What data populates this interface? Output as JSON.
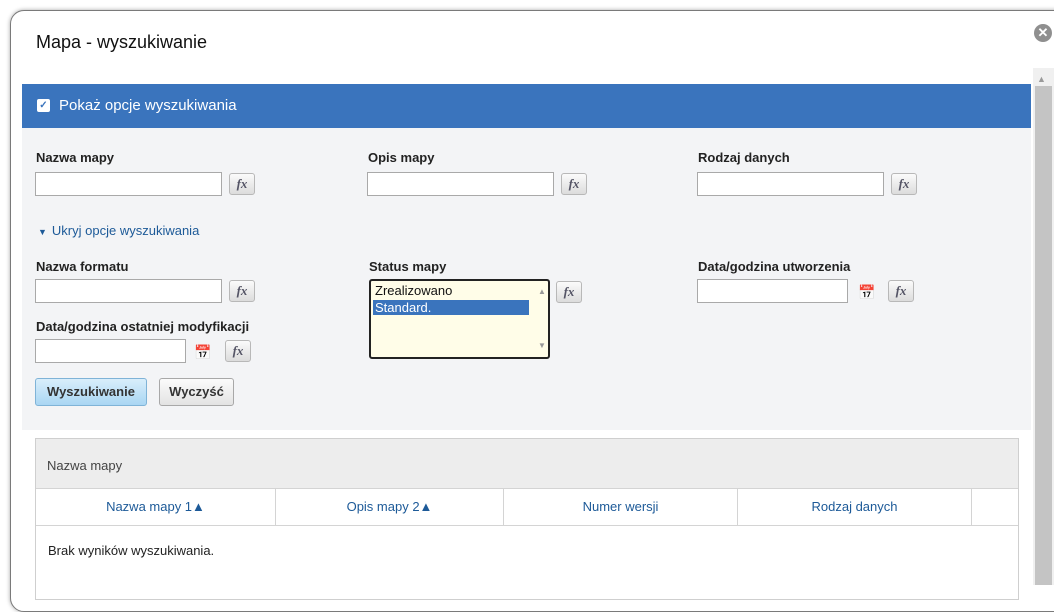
{
  "dialog": {
    "title": "Mapa - wyszukiwanie",
    "close_icon": "close-icon"
  },
  "panel": {
    "header_label": "Pokaż opcje wyszukiwania",
    "toggle_label": "Ukryj opcje wyszukiwania",
    "accent_color": "#3a74bd"
  },
  "fields": {
    "map_name": {
      "label": "Nazwa mapy",
      "value": ""
    },
    "map_description": {
      "label": "Opis mapy",
      "value": ""
    },
    "data_type": {
      "label": "Rodzaj danych",
      "value": ""
    },
    "format_name": {
      "label": "Nazwa formatu",
      "value": ""
    },
    "map_status": {
      "label": "Status mapy",
      "options": [
        "Zrealizowano",
        "Standard."
      ],
      "selected": "Standard."
    },
    "created": {
      "label": "Data/godzina utworzenia",
      "value": ""
    },
    "modified": {
      "label": "Data/godzina ostatniej modyfikacji",
      "value": ""
    }
  },
  "fx_label": "fx",
  "buttons": {
    "search": "Wyszukiwanie",
    "clear": "Wyczyść"
  },
  "results": {
    "title": "Nazwa mapy",
    "columns": [
      "Nazwa mapy 1▲",
      "Opis mapy 2▲",
      "Numer wersji",
      "Rodzaj danych"
    ],
    "empty_message": "Brak wyników wyszukiwania."
  }
}
